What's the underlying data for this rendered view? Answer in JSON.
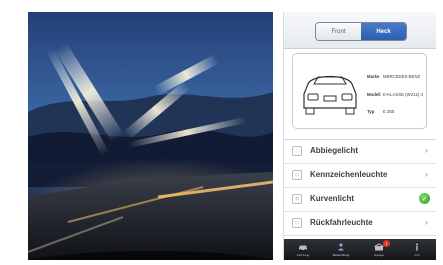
{
  "photo": {
    "alt": "Night highway photo with motion-blurred street lights"
  },
  "segmented": {
    "left": "Front",
    "right": "Heck"
  },
  "vehicle": {
    "labels": {
      "make": "Marke",
      "model": "Modell",
      "type": "Typ"
    },
    "values": {
      "make": "MERCEDES-BENZ",
      "model": "E-KLASSE (W212) 4",
      "type": "E 350"
    }
  },
  "rows": [
    {
      "label": "Abbiegelicht",
      "icon": "bulb-icon",
      "status": "chevron"
    },
    {
      "label": "Kennzeichenleuchte",
      "icon": "plate-light-icon",
      "status": "chevron"
    },
    {
      "label": "Kurvenlicht",
      "icon": "curve-light-icon",
      "status": "ok"
    },
    {
      "label": "Rückfahrleuchte",
      "icon": "reverse-light-icon",
      "status": "chevron"
    }
  ],
  "tabbar": {
    "items": [
      {
        "label": "Fahrzeug",
        "icon": "car-icon"
      },
      {
        "label": "Beleuchtung",
        "icon": "person-icon"
      },
      {
        "label": "Garage",
        "icon": "garage-icon",
        "badge": "1"
      },
      {
        "label": "Info",
        "icon": "info-icon"
      }
    ]
  },
  "colors": {
    "accent": "#2b5fb2",
    "ok_green": "#2f9a24",
    "badge_red": "#e0322d"
  }
}
